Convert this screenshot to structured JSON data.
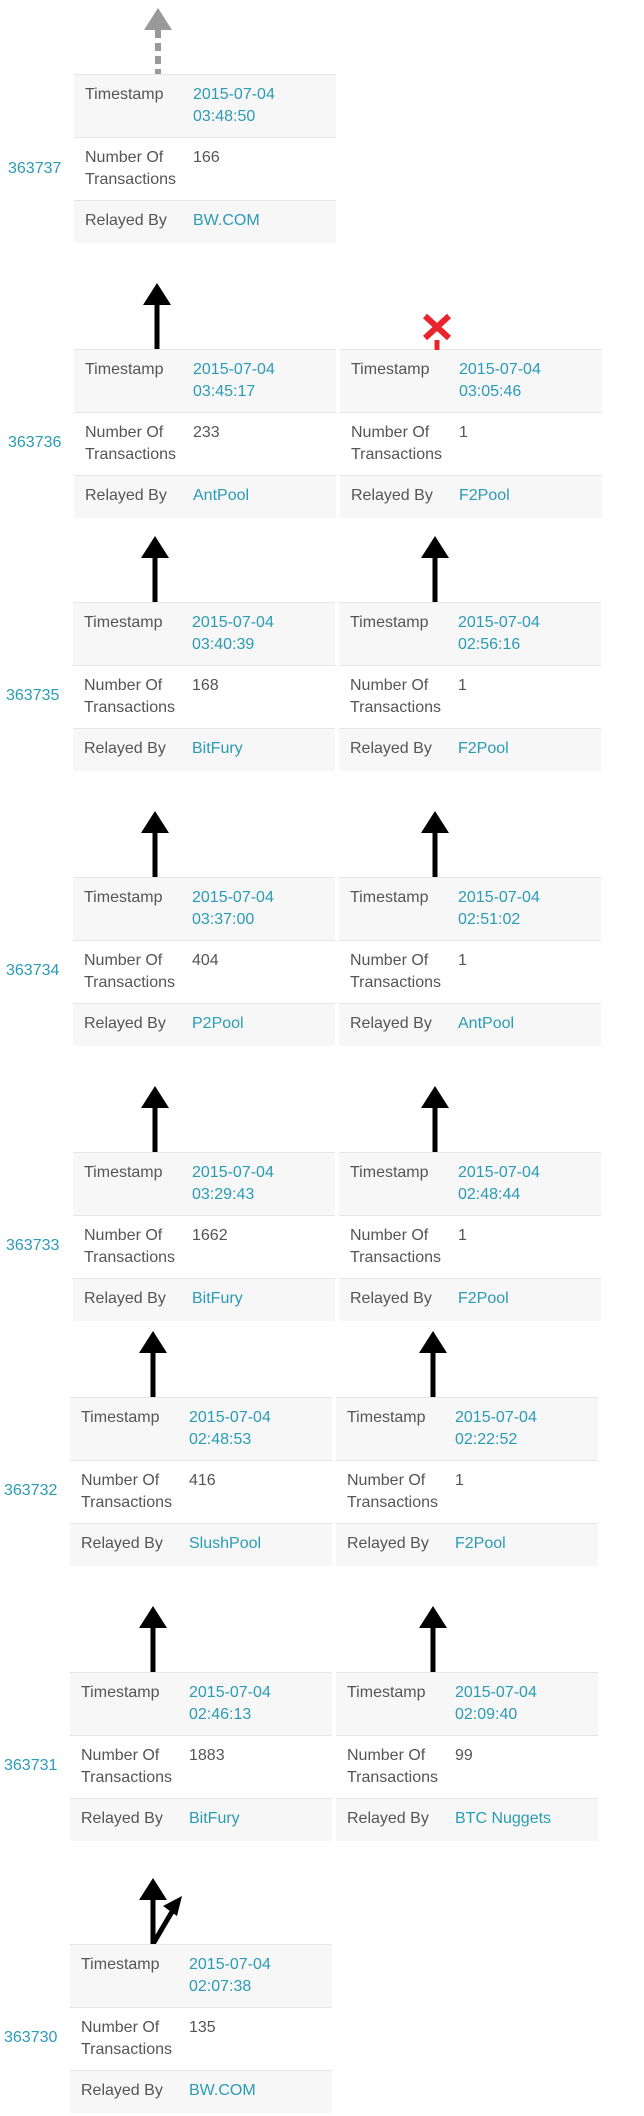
{
  "labels": {
    "timestamp": "Timestamp",
    "num_tx": "Number Of Transactions",
    "relayed_by": "Relayed By"
  },
  "rows": [
    {
      "height": "363737",
      "main": {
        "date": "2015-07-04",
        "time": "03:48:50",
        "tx": "166",
        "pool": "BW.COM"
      }
    },
    {
      "height": "363736",
      "main": {
        "date": "2015-07-04",
        "time": "03:45:17",
        "tx": "233",
        "pool": "AntPool"
      },
      "orphan": {
        "date": "2015-07-04",
        "time": "03:05:46",
        "tx": "1",
        "pool": "F2Pool"
      }
    },
    {
      "height": "363735",
      "main": {
        "date": "2015-07-04",
        "time": "03:40:39",
        "tx": "168",
        "pool": "BitFury"
      },
      "orphan": {
        "date": "2015-07-04",
        "time": "02:56:16",
        "tx": "1",
        "pool": "F2Pool"
      }
    },
    {
      "height": "363734",
      "main": {
        "date": "2015-07-04",
        "time": "03:37:00",
        "tx": "404",
        "pool": "P2Pool"
      },
      "orphan": {
        "date": "2015-07-04",
        "time": "02:51:02",
        "tx": "1",
        "pool": "AntPool"
      }
    },
    {
      "height": "363733",
      "main": {
        "date": "2015-07-04",
        "time": "03:29:43",
        "tx": "1662",
        "pool": "BitFury"
      },
      "orphan": {
        "date": "2015-07-04",
        "time": "02:48:44",
        "tx": "1",
        "pool": "F2Pool"
      }
    },
    {
      "height": "363732",
      "main": {
        "date": "2015-07-04",
        "time": "02:48:53",
        "tx": "416",
        "pool": "SlushPool"
      },
      "orphan": {
        "date": "2015-07-04",
        "time": "02:22:52",
        "tx": "1",
        "pool": "F2Pool"
      }
    },
    {
      "height": "363731",
      "main": {
        "date": "2015-07-04",
        "time": "02:46:13",
        "tx": "1883",
        "pool": "BitFury"
      },
      "orphan": {
        "date": "2015-07-04",
        "time": "02:09:40",
        "tx": "99",
        "pool": "BTC Nuggets"
      }
    },
    {
      "height": "363730",
      "main": {
        "date": "2015-07-04",
        "time": "02:07:38",
        "tx": "135",
        "pool": "BW.COM"
      }
    }
  ],
  "colors": {
    "link": "#2a9bb5",
    "arrow": "#000000",
    "dashed_arrow": "#999999",
    "x_mark": "#e8242c"
  },
  "icons": {
    "up": "up-arrow-icon",
    "dashed_up": "dashed-up-arrow-icon",
    "x": "x-mark-icon",
    "split": "split-arrow-icon"
  }
}
